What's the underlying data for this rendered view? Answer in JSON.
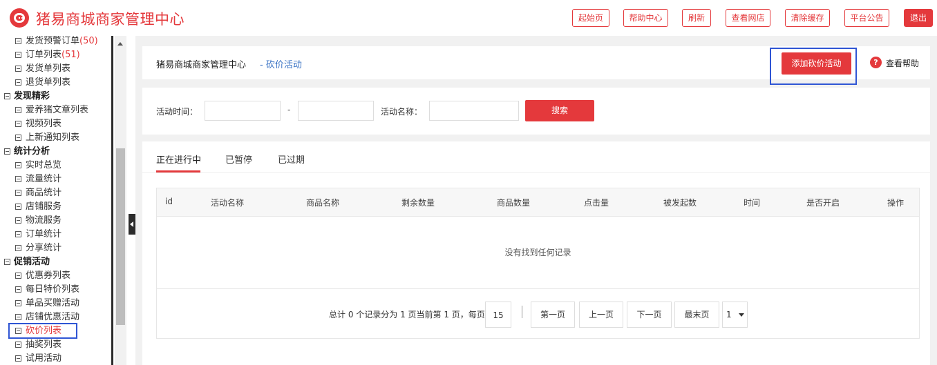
{
  "app": {
    "title": "猪易商城商家管理中心"
  },
  "topbar": {
    "buttons": [
      "起始页",
      "帮助中心",
      "刷新",
      "查看网店",
      "清除缓存",
      "平台公告",
      "退出"
    ]
  },
  "sidebar": {
    "items": [
      {
        "label": "发货预警订单",
        "count": "(50)"
      },
      {
        "label": "订单列表",
        "count": "(51)"
      },
      {
        "label": "发货单列表"
      },
      {
        "label": "退货单列表"
      },
      {
        "label": "发现精彩"
      },
      {
        "label": "爱养猪文章列表"
      },
      {
        "label": "视频列表"
      },
      {
        "label": "上新通知列表"
      },
      {
        "label": "统计分析"
      },
      {
        "label": "实时总览"
      },
      {
        "label": "流量统计"
      },
      {
        "label": "商品统计"
      },
      {
        "label": "店铺服务"
      },
      {
        "label": "物流服务"
      },
      {
        "label": "订单统计"
      },
      {
        "label": "分享统计"
      },
      {
        "label": "促销活动"
      },
      {
        "label": "优惠券列表"
      },
      {
        "label": "每日特价列表"
      },
      {
        "label": "单品买赠活动"
      },
      {
        "label": "店铺优惠活动"
      },
      {
        "label": "砍价列表"
      },
      {
        "label": "抽奖列表"
      },
      {
        "label": "试用活动"
      }
    ]
  },
  "header": {
    "title": "猪易商城商家管理中心",
    "breadcrumb": "- 砍价活动",
    "add_button": "添加砍价活动",
    "help_icon": "?",
    "help_label": "查看帮助"
  },
  "search": {
    "time_label": "活动时间：",
    "dash": "-",
    "name_label": "活动名称：",
    "button": "搜索"
  },
  "tabs": [
    "正在进行中",
    "已暂停",
    "已过期"
  ],
  "table": {
    "columns": [
      "id",
      "活动名称",
      "商品名称",
      "剩余数量",
      "商品数量",
      "点击量",
      "被发起数",
      "时间",
      "是否开启",
      "操作"
    ],
    "empty_text": "没有找到任何记录"
  },
  "pagination": {
    "summary": "总计 0 个记录分为 1 页当前第 1 页，每页",
    "page_size": "15",
    "buttons": [
      "第一页",
      "上一页",
      "下一页",
      "最末页"
    ],
    "page_select": "1"
  },
  "colors": {
    "accent": "#e4393c",
    "link": "#3a73c4",
    "highlight": "#2f55d4"
  }
}
